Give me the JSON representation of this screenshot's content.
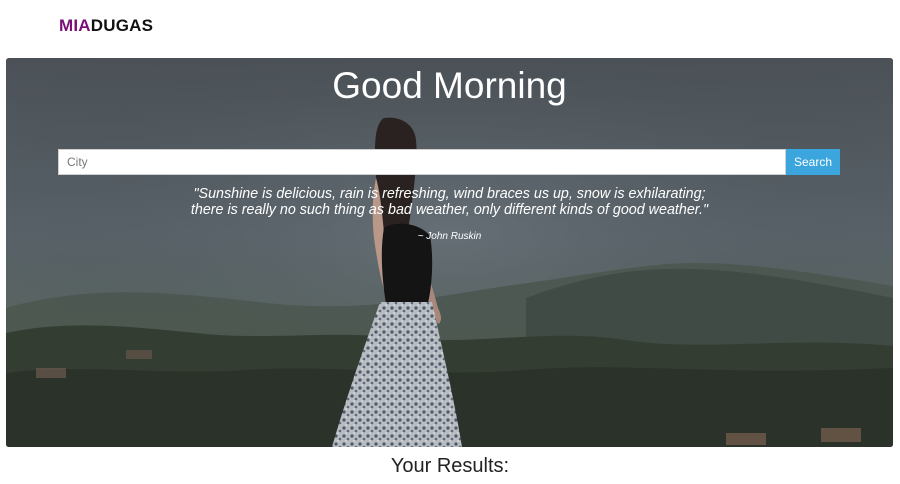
{
  "header": {
    "logo_part1": "MIA",
    "logo_part2": "DUGAS",
    "logo_colors": {
      "part1": "#7a0f7a",
      "part2": "#111111"
    }
  },
  "hero": {
    "greeting": "Good Morning",
    "search": {
      "placeholder": "City",
      "value": "",
      "button_label": "Search",
      "button_color": "#3aa6dd"
    },
    "quote": {
      "line1": "\"Sunshine is delicious, rain is refreshing, wind braces us up, snow is exhilarating;",
      "line2": "there is really no such thing as bad weather, only different kinds of good weather.\"",
      "author": "~ John Ruskin"
    },
    "background_image": "girl-standing-on-hill"
  },
  "results": {
    "title": "Your Results:"
  }
}
